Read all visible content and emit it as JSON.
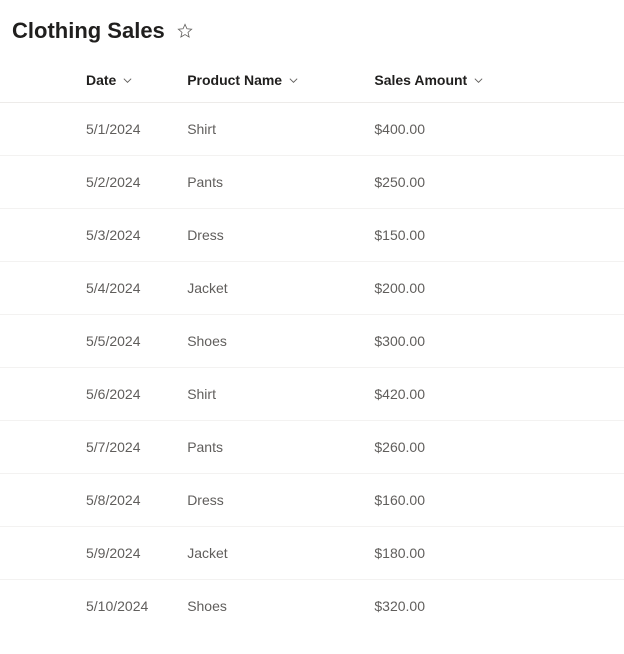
{
  "header": {
    "title": "Clothing Sales"
  },
  "table": {
    "columns": {
      "date": "Date",
      "product": "Product Name",
      "amount": "Sales Amount"
    },
    "rows": [
      {
        "date": "5/1/2024",
        "product": "Shirt",
        "amount": "$400.00"
      },
      {
        "date": "5/2/2024",
        "product": "Pants",
        "amount": "$250.00"
      },
      {
        "date": "5/3/2024",
        "product": "Dress",
        "amount": "$150.00"
      },
      {
        "date": "5/4/2024",
        "product": "Jacket",
        "amount": "$200.00"
      },
      {
        "date": "5/5/2024",
        "product": "Shoes",
        "amount": "$300.00"
      },
      {
        "date": "5/6/2024",
        "product": "Shirt",
        "amount": "$420.00"
      },
      {
        "date": "5/7/2024",
        "product": "Pants",
        "amount": "$260.00"
      },
      {
        "date": "5/8/2024",
        "product": "Dress",
        "amount": "$160.00"
      },
      {
        "date": "5/9/2024",
        "product": "Jacket",
        "amount": "$180.00"
      },
      {
        "date": "5/10/2024",
        "product": "Shoes",
        "amount": "$320.00"
      }
    ]
  },
  "chart_data": {
    "type": "table",
    "title": "Clothing Sales",
    "columns": [
      "Date",
      "Product Name",
      "Sales Amount"
    ],
    "rows": [
      [
        "5/1/2024",
        "Shirt",
        400.0
      ],
      [
        "5/2/2024",
        "Pants",
        250.0
      ],
      [
        "5/3/2024",
        "Dress",
        150.0
      ],
      [
        "5/4/2024",
        "Jacket",
        200.0
      ],
      [
        "5/5/2024",
        "Shoes",
        300.0
      ],
      [
        "5/6/2024",
        "Shirt",
        420.0
      ],
      [
        "5/7/2024",
        "Pants",
        260.0
      ],
      [
        "5/8/2024",
        "Dress",
        160.0
      ],
      [
        "5/9/2024",
        "Jacket",
        180.0
      ],
      [
        "5/10/2024",
        "Shoes",
        320.0
      ]
    ]
  }
}
